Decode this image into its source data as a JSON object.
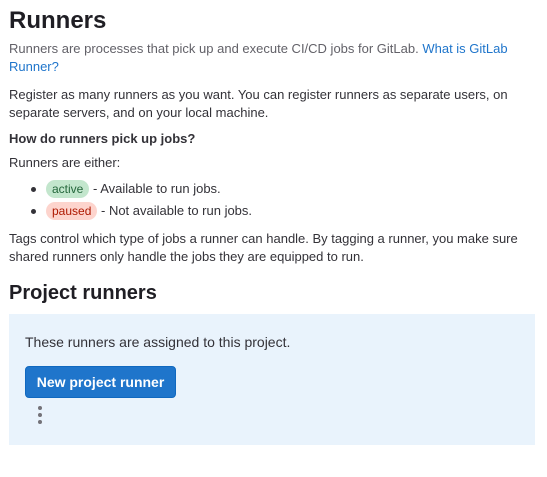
{
  "header": {
    "title": "Runners",
    "description": "Runners are processes that pick up and execute CI/CD jobs for GitLab.",
    "link": "What is GitLab Runner?"
  },
  "intro": {
    "register_text": "Register as many runners as you want. You can register runners as separate users, on separate servers, and on your local machine.",
    "question": "How do runners pick up jobs?",
    "either": "Runners are either:",
    "states": [
      {
        "badge": "active",
        "text": "- Available to run jobs."
      },
      {
        "badge": "paused",
        "text": "- Not available to run jobs."
      }
    ],
    "tags_text": "Tags control which type of jobs a runner can handle. By tagging a runner, you make sure shared runners only handle the jobs they are equipped to run."
  },
  "project_runners": {
    "title": "Project runners",
    "panel_text": "These runners are assigned to this project.",
    "new_button": "New project runner"
  }
}
